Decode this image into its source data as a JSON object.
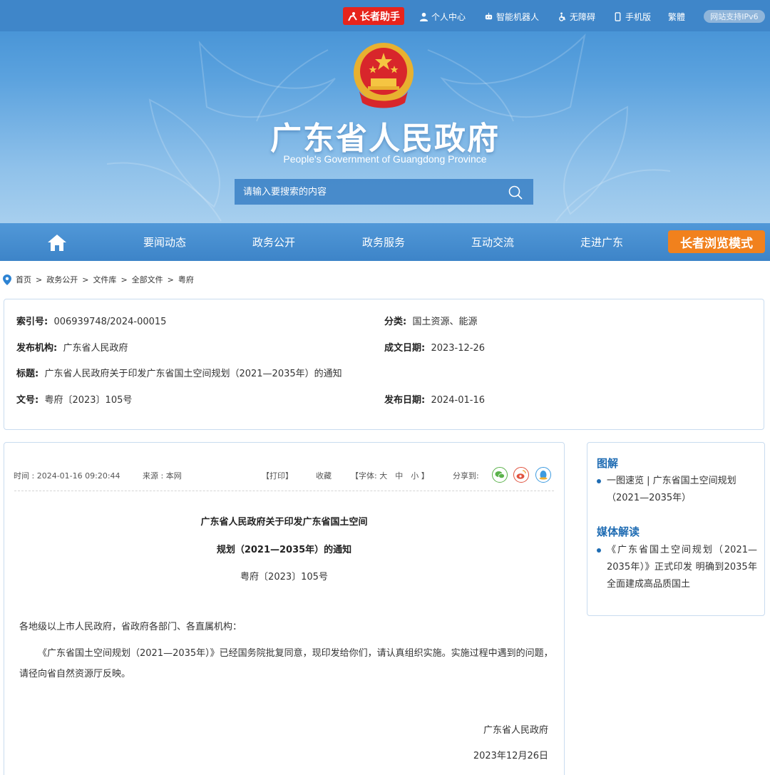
{
  "topbar": {
    "elder_helper": "长者助手",
    "personal_center": "个人中心",
    "robot": "智能机器人",
    "accessibility": "无障碍",
    "mobile": "手机版",
    "traditional": "繁體",
    "ipv6": "网站支持IPv6"
  },
  "header": {
    "title": "广东省人民政府",
    "subtitle": "People's Government of Guangdong Province",
    "search_placeholder": "请输入要搜索的内容"
  },
  "nav": {
    "items": [
      "要闻动态",
      "政务公开",
      "政务服务",
      "互动交流",
      "走进广东"
    ],
    "elder_mode": "长者浏览模式"
  },
  "breadcrumb": [
    "首页",
    "政务公开",
    "文件库",
    "全部文件",
    "粤府"
  ],
  "meta": {
    "index_label": "索引号:",
    "index_value": "006939748/2024-00015",
    "category_label": "分类:",
    "category_value": "国土资源、能源",
    "publisher_label": "发布机构:",
    "publisher_value": "广东省人民政府",
    "written_date_label": "成文日期:",
    "written_date_value": "2023-12-26",
    "title_label": "标题:",
    "title_value": "广东省人民政府关于印发广东省国土空间规划（2021—2035年）的通知",
    "docno_label": "文号:",
    "docno_value": "粤府〔2023〕105号",
    "publish_date_label": "发布日期:",
    "publish_date_value": "2024-01-16"
  },
  "article": {
    "time": "时间 : 2024-01-16 09:20:44",
    "source": "来源 : 本网",
    "print": "【打印】",
    "favorite": "收藏",
    "font_size": "【字体: 大　中　小 】",
    "share": "分享到:",
    "title_line1": "广东省人民政府关于印发广东省国土空间",
    "title_line2": "规划（2021—2035年）的通知",
    "doc_number": "粤府〔2023〕105号",
    "salutation": "各地级以上市人民政府，省政府各部门、各直属机构：",
    "body": "《广东省国土空间规划（2021—2035年）》已经国务院批复同意，现印发给你们，请认真组织实施。实施过程中遇到的问题，请径向省自然资源厅反映。",
    "signature": "广东省人民政府",
    "date": "2023年12月26日"
  },
  "sidebar": {
    "infographic_title": "图解",
    "infographic_item": "一图速览 | 广东省国土空间规划（2021—2035年）",
    "media_title": "媒体解读",
    "media_item": "《广东省国土空间规划（2021—2035年）》正式印发 明确到2035年全面建成高品质国土"
  },
  "colors": {
    "topbar": "#3f86c9",
    "nav": "#3d84c8",
    "elder_helper": "#e7241c",
    "elder_mode": "#f1811d",
    "accent_blue": "#1f6cb3",
    "wechat": "#5bb24b",
    "weibo": "#e0533f",
    "qq": "#3d9be0"
  }
}
